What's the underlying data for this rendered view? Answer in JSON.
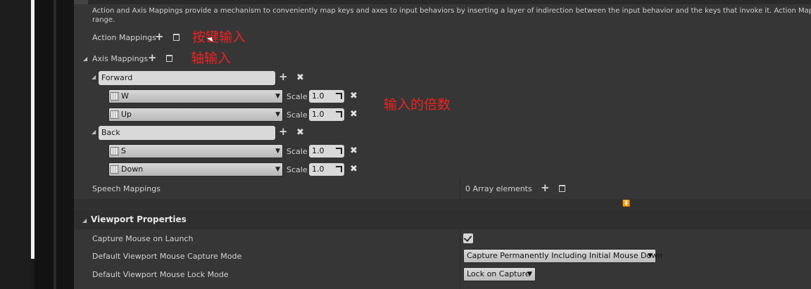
{
  "description": "Action and Axis Mappings provide a mechanism to conveniently map keys and axes to input behaviors by inserting a layer of indirection between the input behavior and the keys that invoke it. Action Mapp",
  "description_line2": "range.",
  "action_mappings": {
    "label": "Action Mappings"
  },
  "axis_mappings": {
    "label": "Axis Mappings"
  },
  "annotations": {
    "action": "按键输入",
    "axis": "轴输入",
    "scale": "输入的倍数"
  },
  "axes": [
    {
      "name": "Forward",
      "keys": [
        {
          "key": "W",
          "scale_label": "Scale",
          "scale": "1.0"
        },
        {
          "key": "Up",
          "scale_label": "Scale",
          "scale": "1.0"
        }
      ]
    },
    {
      "name": "Back",
      "keys": [
        {
          "key": "S",
          "scale_label": "Scale",
          "scale": "1.0"
        },
        {
          "key": "Down",
          "scale_label": "Scale",
          "scale": "1.0"
        }
      ]
    }
  ],
  "speech_mappings": {
    "label": "Speech Mappings",
    "value": "0 Array elements"
  },
  "viewport": {
    "title": "Viewport Properties",
    "capture_mouse": {
      "label": "Capture Mouse on Launch",
      "checked": true
    },
    "capture_mode": {
      "label": "Default Viewport Mouse Capture Mode",
      "value": "Capture Permanently Including Initial Mouse Down"
    },
    "lock_mode": {
      "label": "Default Viewport Mouse Lock Mode",
      "value": "Lock on Capture"
    }
  },
  "colors": {
    "panel": "#363636",
    "annotation": "#ee2222",
    "field": "#d9d9d9"
  }
}
